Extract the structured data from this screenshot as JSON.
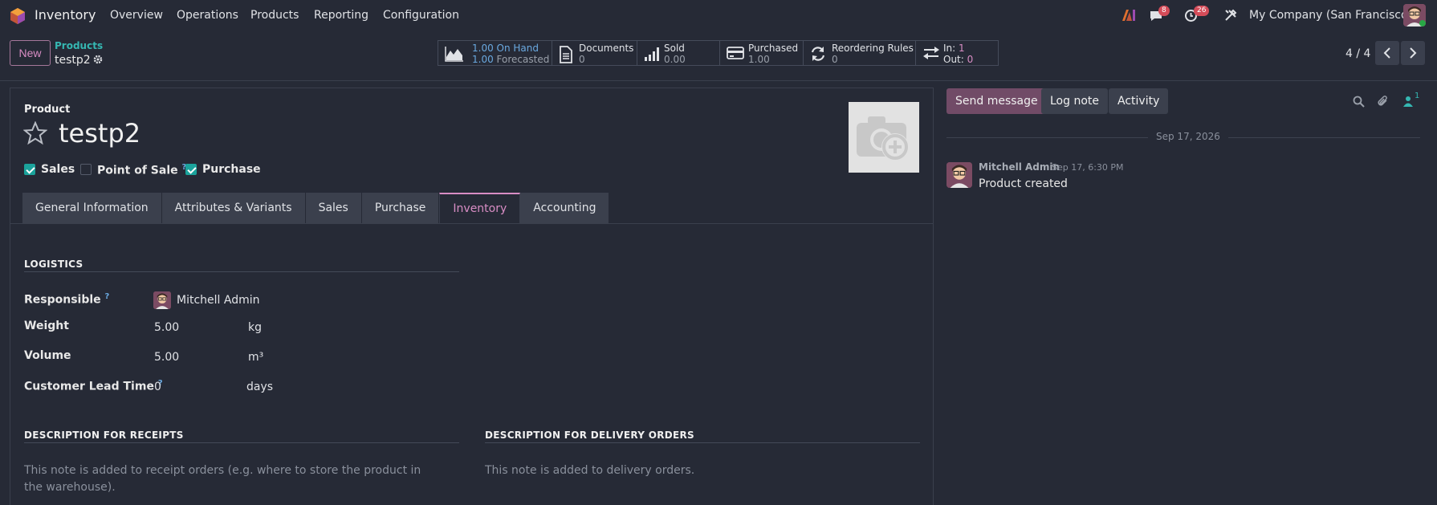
{
  "navbar": {
    "app_name": "Inventory",
    "menus": [
      "Overview",
      "Operations",
      "Products",
      "Reporting",
      "Configuration"
    ],
    "messages_count": "8",
    "activities_count": "26",
    "company": "My Company (San Francisco)"
  },
  "control": {
    "new_label": "New",
    "breadcrumb_parent": "Products",
    "breadcrumb_current": "testp2",
    "smart_buttons": {
      "onhand_value": "1.00",
      "onhand_label": "On Hand",
      "forecast_value": "1.00",
      "forecast_label": "Forecasted",
      "documents_label": "Documents",
      "documents_value": "0",
      "sold_label": "Sold",
      "sold_value": "0.00",
      "purchased_label": "Purchased",
      "purchased_value": "1.00",
      "reorder_label": "Reordering Rules",
      "reorder_value": "0",
      "in_label": "In:",
      "in_value": "1",
      "out_label": "Out:",
      "out_value": "0"
    },
    "pager": "4 / 4"
  },
  "form": {
    "product_label": "Product",
    "name": "testp2",
    "options": [
      {
        "label": "Sales",
        "checked": true
      },
      {
        "label": "Point of Sale",
        "checked": false
      },
      {
        "label": "Purchase",
        "checked": true
      }
    ],
    "help_mark": "?",
    "tabs": [
      "General Information",
      "Attributes & Variants",
      "Sales",
      "Purchase",
      "Inventory",
      "Accounting"
    ],
    "active_tab": "Inventory",
    "logistics": {
      "title": "LOGISTICS",
      "responsible_label": "Responsible",
      "responsible_value": "Mitchell Admin",
      "weight_label": "Weight",
      "weight_value": "5.00",
      "weight_unit": "kg",
      "volume_label": "Volume",
      "volume_value": "5.00",
      "volume_unit": "m³",
      "lead_label": "Customer Lead Time",
      "lead_value": "0",
      "lead_unit": "days"
    },
    "receipts": {
      "title": "DESCRIPTION FOR RECEIPTS",
      "placeholder": "This note is added to receipt orders (e.g. where to store the product in the warehouse)."
    },
    "delivery": {
      "title": "DESCRIPTION FOR DELIVERY ORDERS",
      "placeholder": "This note is added to delivery orders."
    }
  },
  "chatter": {
    "send_message": "Send message",
    "log_note": "Log note",
    "activity": "Activity",
    "followers_count": "1",
    "date": "Sep 17, 2026",
    "author": "Mitchell Admin",
    "time": "Sep 17, 6:30 PM",
    "body": "Product created"
  },
  "colors": {
    "accent": "#d88dc4",
    "primary": "#714b67",
    "teal": "#35b7b2",
    "background": "#262a36"
  }
}
